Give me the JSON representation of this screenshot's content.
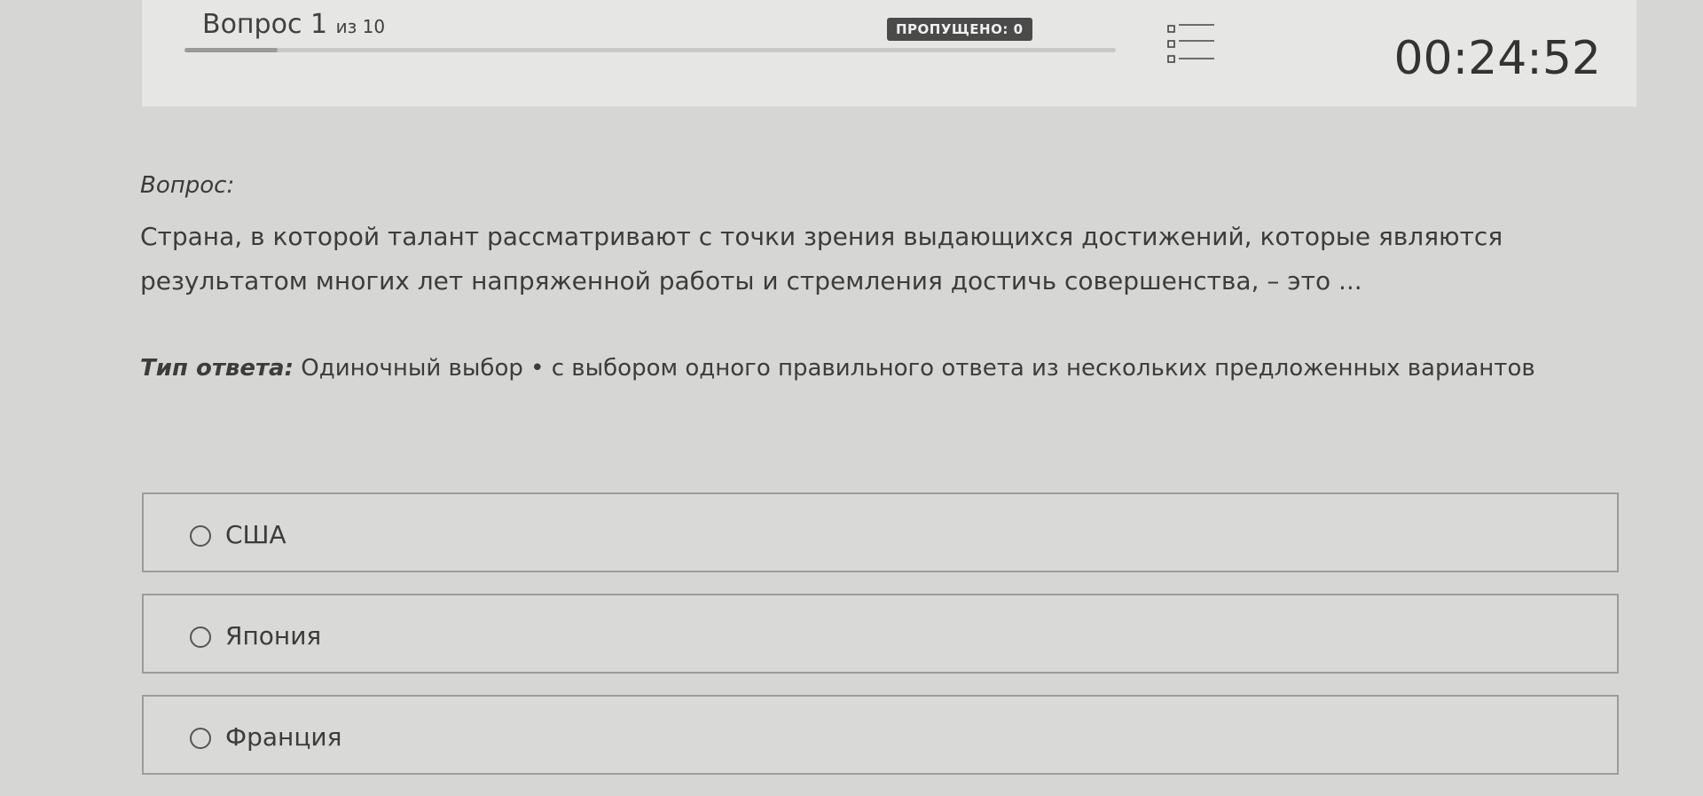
{
  "header": {
    "question_word": "Вопрос",
    "question_number": "1",
    "of_text": "из 10",
    "progress": 0.1,
    "skipped_label": "ПРОПУЩЕНО: 0",
    "timer": "00:24:52",
    "list_icon": "list-icon"
  },
  "question": {
    "label": "Вопрос:",
    "text": "Страна, в которой талант рассматривают с точки зрения выдающихся достижений, которые являются результатом многих лет напряженной работы и стремления достичь совершенства, – это ...",
    "answer_type_label": "Тип ответа:",
    "answer_type_value": "Одиночный выбор • с выбором одного правильного ответа из нескольких предложенных вариантов"
  },
  "options": [
    {
      "label": "США",
      "selected": false
    },
    {
      "label": "Япония",
      "selected": false
    },
    {
      "label": "Франция",
      "selected": false
    }
  ]
}
